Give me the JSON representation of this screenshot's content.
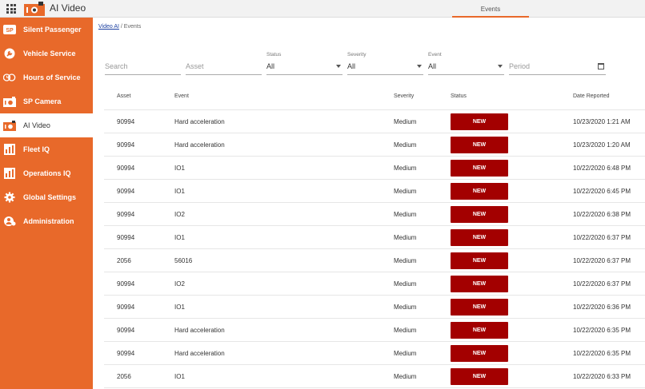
{
  "app": {
    "title": "AI Video"
  },
  "top_tabs": [
    {
      "label": "Events"
    }
  ],
  "colors": {
    "accent": "#e8692a",
    "badge": "#a30000"
  },
  "sidebar": {
    "items": [
      {
        "label": "Silent Passenger",
        "icon": "sp-icon"
      },
      {
        "label": "Vehicle Service",
        "icon": "wrench-icon"
      },
      {
        "label": "Hours of Service",
        "icon": "hos-icon"
      },
      {
        "label": "SP Camera",
        "icon": "camera-icon"
      },
      {
        "label": "AI Video",
        "icon": "video-camera-icon",
        "active": true
      },
      {
        "label": "Fleet IQ",
        "icon": "bar-chart-icon"
      },
      {
        "label": "Operations IQ",
        "icon": "bar-chart-icon"
      },
      {
        "label": "Global Settings",
        "icon": "gear-icon"
      },
      {
        "label": "Administration",
        "icon": "admin-icon"
      }
    ]
  },
  "breadcrumb": {
    "link": "Video AI",
    "separator": " / ",
    "current": "Events"
  },
  "filters": {
    "search_placeholder": "Search",
    "asset_placeholder": "Asset",
    "status": {
      "label": "Status",
      "value": "All"
    },
    "severity": {
      "label": "Severity",
      "value": "All"
    },
    "event": {
      "label": "Event",
      "value": "All"
    },
    "period_placeholder": "Period"
  },
  "table": {
    "headers": {
      "asset": "Asset",
      "event": "Event",
      "severity": "Severity",
      "status": "Status",
      "date": "Date Reported"
    },
    "rows": [
      {
        "asset": "90994",
        "event": "Hard acceleration",
        "severity": "Medium",
        "status": "NEW",
        "date": "10/23/2020 1:21 AM"
      },
      {
        "asset": "90994",
        "event": "Hard acceleration",
        "severity": "Medium",
        "status": "NEW",
        "date": "10/23/2020 1:20 AM"
      },
      {
        "asset": "90994",
        "event": "IO1",
        "severity": "Medium",
        "status": "NEW",
        "date": "10/22/2020 6:48 PM"
      },
      {
        "asset": "90994",
        "event": "IO1",
        "severity": "Medium",
        "status": "NEW",
        "date": "10/22/2020 6:45 PM"
      },
      {
        "asset": "90994",
        "event": "IO2",
        "severity": "Medium",
        "status": "NEW",
        "date": "10/22/2020 6:38 PM"
      },
      {
        "asset": "90994",
        "event": "IO1",
        "severity": "Medium",
        "status": "NEW",
        "date": "10/22/2020 6:37 PM"
      },
      {
        "asset": "2056",
        "event": "56016",
        "severity": "Medium",
        "status": "NEW",
        "date": "10/22/2020 6:37 PM"
      },
      {
        "asset": "90994",
        "event": "IO2",
        "severity": "Medium",
        "status": "NEW",
        "date": "10/22/2020 6:37 PM"
      },
      {
        "asset": "90994",
        "event": "IO1",
        "severity": "Medium",
        "status": "NEW",
        "date": "10/22/2020 6:36 PM"
      },
      {
        "asset": "90994",
        "event": "Hard acceleration",
        "severity": "Medium",
        "status": "NEW",
        "date": "10/22/2020 6:35 PM"
      },
      {
        "asset": "90994",
        "event": "Hard acceleration",
        "severity": "Medium",
        "status": "NEW",
        "date": "10/22/2020 6:35 PM"
      },
      {
        "asset": "2056",
        "event": "IO1",
        "severity": "Medium",
        "status": "NEW",
        "date": "10/22/2020 6:33 PM"
      }
    ]
  }
}
